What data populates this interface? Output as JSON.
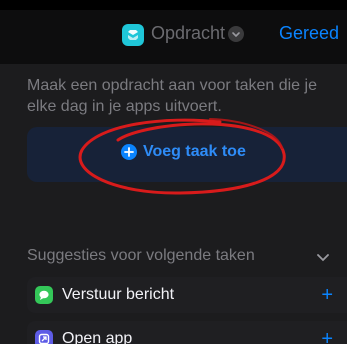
{
  "navbar": {
    "title": "Opdracht",
    "done_label": "Gereed",
    "app_icon": "shortcuts-icon",
    "app_icon_color": "#1fc6d8"
  },
  "description": "Maak een opdracht aan voor taken die je elke dag in je apps uitvoert.",
  "add_action": {
    "label": "Voeg taak toe",
    "icon": "plus-circle-icon",
    "color": "#0a84ff"
  },
  "annotation": {
    "type": "hand-drawn-circle",
    "color": "#d81b1b"
  },
  "suggestions": {
    "header": "Suggesties voor volgende taken",
    "items": [
      {
        "label": "Verstuur bericht",
        "icon": "messages-icon",
        "icon_color": "#34c759",
        "add_label": "+"
      },
      {
        "label": "Open app",
        "icon": "open-app-icon",
        "icon_color": "#5e5ce6",
        "add_label": "+"
      }
    ]
  }
}
